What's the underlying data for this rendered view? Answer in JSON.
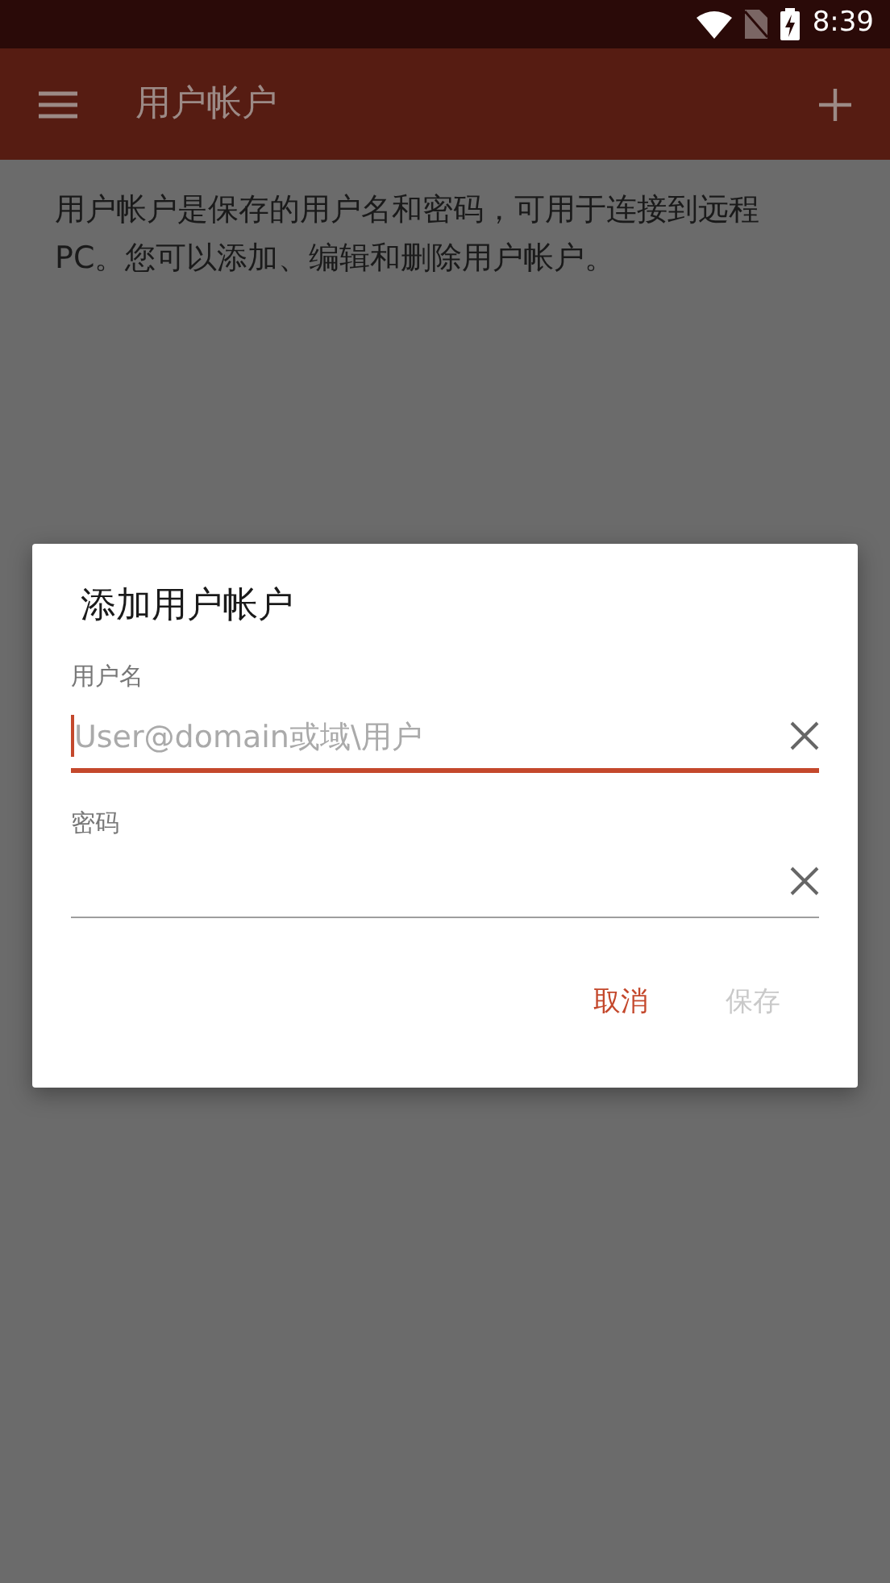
{
  "status_bar": {
    "time": "8:39"
  },
  "app_bar": {
    "title": "用户帐户"
  },
  "description": "用户帐户是保存的用户名和密码，可用于连接到远程PC。您可以添加、编辑和删除用户帐户。",
  "dialog": {
    "title": "添加用户帐户",
    "fields": [
      {
        "label": "用户名",
        "placeholder": "User@domain或域\\用户",
        "focused": true
      },
      {
        "label": "密码",
        "focused": false
      }
    ],
    "buttons": [
      {
        "label": "取消",
        "disabled": false
      },
      {
        "label": "保存",
        "disabled": true
      }
    ]
  }
}
